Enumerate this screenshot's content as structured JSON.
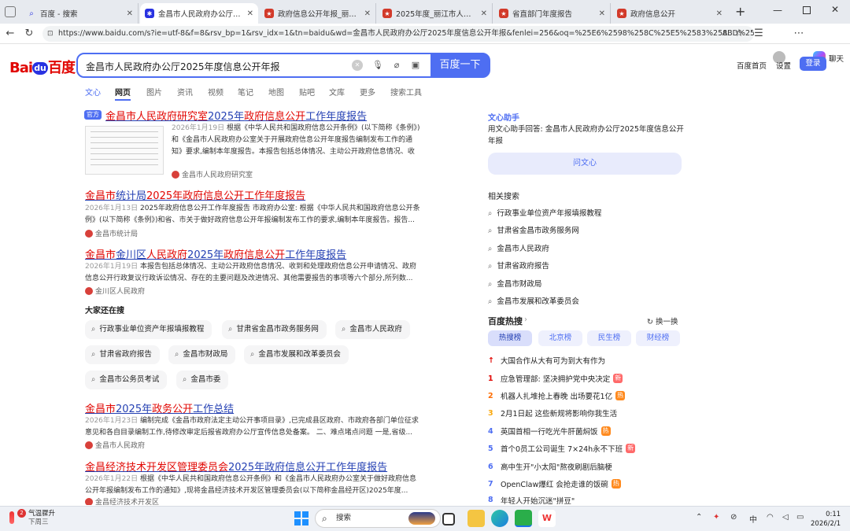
{
  "tabs": [
    {
      "title": "百度 - 搜索",
      "icon": "search-icon",
      "active": false
    },
    {
      "title": "金昌市人民政府办公厅2025年",
      "icon": "baidu-icon",
      "active": true
    },
    {
      "title": "政府信息公开年报_丽江市人民",
      "icon": "gov-emblem-icon",
      "active": false
    },
    {
      "title": "2025年度_丽江市人民政府",
      "icon": "gov-emblem-icon",
      "active": false
    },
    {
      "title": "省直部门年度报告",
      "icon": "gov-emblem-icon",
      "active": false
    },
    {
      "title": "政府信息公开",
      "icon": "gov-emblem-icon",
      "active": false
    }
  ],
  "browser": {
    "url": "https://www.baidu.com/s?ie=utf-8&f=8&rsv_bp=1&rsv_idx=1&tn=baidu&wd=金昌市人民政府办公厅2025年度信息公开年报&fenlei=256&oq=%25E6%2598%258C%25E5%2583%258BD%25...",
    "chat_label": "聊天"
  },
  "baidu": {
    "logo_left": "Bai",
    "logo_paw": "du",
    "logo_right": "百度",
    "query": "金昌市人民政府办公厅2025年度信息公开年报",
    "search_button": "百度一下",
    "top_links": [
      "百度首页",
      "设置"
    ],
    "login": "登录"
  },
  "result_tabs": [
    "文心",
    "网页",
    "图片",
    "资讯",
    "视频",
    "笔记",
    "地图",
    "贴吧",
    "文库",
    "更多",
    "搜索工具"
  ],
  "results": [
    {
      "badge": "官方",
      "title_parts": [
        [
          "金昌市人民政府研究室",
          1
        ],
        [
          "2025年",
          0
        ],
        [
          "政府信息公开",
          1
        ],
        [
          "工作年度报告",
          0
        ]
      ],
      "date": "2026年1月19日",
      "desc": "根据《中华人民共和国政府信息公开条例》(以下简称《条例》)和《金昌市人民政府办公室关于开展政府信息公开年度报告编制发布工作的通知》要求,编制本年度报告。本报告包括总体情况、主动公开政府信息情况、收到...",
      "source": "金昌市人民政府研究室"
    },
    {
      "title_parts": [
        [
          "金昌市",
          1
        ],
        [
          "统计局",
          0
        ],
        [
          "2025年政府信息公开工作年度报告",
          1
        ]
      ],
      "date": "2026年1月13日",
      "desc": "2025年政府信息公开工作年度报告 市政府办公室: 根据《中华人民共和国政府信息公开条例》(以下简称《条例》)和省、市关于做好政府信息公开年报编制发布工作的要求,编制本年度报告。报告...",
      "source": "金昌市统计局"
    },
    {
      "title_parts": [
        [
          "金昌市",
          1
        ],
        [
          "金川区",
          0
        ],
        [
          "人民政府",
          1
        ],
        [
          "2025年",
          0
        ],
        [
          "政府信息公开",
          1
        ],
        [
          "工作年度报告",
          0
        ]
      ],
      "date": "2026年1月19日",
      "desc": "本报告包括总体情况、主动公开政府信息情况、收到和处理政府信息公开申请情况、政府信息公开行政复议行政诉讼情况、存在的主要问题及改进情况、其他需要报告的事项等六个部分,所列数...",
      "source": "金川区人民政府"
    },
    {
      "title_parts": [
        [
          "金昌市",
          1
        ],
        [
          "2025年",
          0
        ],
        [
          "政务公开",
          1
        ],
        [
          "工作总结",
          0
        ]
      ],
      "date": "2026年1月23日",
      "desc": "编制完成《金昌市政府法定主动公开事项目录》,已完成县区政府、市政府各部门单位征求意见和各自目录编制工作,待修改审定后报省政府办公厅宣传信息处备案。 二、难点堵点问题 一是,省级...",
      "source": "金昌市人民政府"
    },
    {
      "title_parts": [
        [
          "金昌经济技术开发区管理委员会",
          1
        ],
        [
          "2025年政府信息公开工作年度报告",
          0
        ]
      ],
      "date": "2026年1月22日",
      "desc": "根据《中华人民共和国政府信息公开条例》和《金昌市人民政府办公室关于做好政府信息公开年报编制发布工作的通知》,现将金昌经济技术开发区管理委员会(以下简称金昌经开区)2025年度...",
      "source": "金昌经济技术开发区"
    }
  ],
  "also_searched": {
    "heading": "大家还在搜",
    "items": [
      "行政事业单位资产年报填报教程",
      "甘肃省金昌市政务服务网",
      "金昌市人民政府",
      "甘肃省政府报告",
      "金昌市财政局",
      "金昌市发展和改革委员会",
      "金昌市公务员考试",
      "金昌市委"
    ]
  },
  "wenxin": {
    "heading": "文心助手",
    "text": "用文心助手回答: 金昌市人民政府办公厅2025年度信息公开年报",
    "button": "问文心"
  },
  "related": {
    "heading": "相关搜索",
    "items": [
      "行政事业单位资产年报填报教程",
      "甘肃省金昌市政务服务网",
      "金昌市人民政府",
      "甘肃省政府报告",
      "金昌市财政局",
      "金昌市发展和改革委员会"
    ]
  },
  "hot": {
    "heading": "百度热搜",
    "refresh": "换一换",
    "tabs": [
      "热搜榜",
      "北京榜",
      "民生榜",
      "财经榜"
    ],
    "items": [
      {
        "rank": "↑",
        "text": "大国合作从大有可为到大有作为",
        "badge": ""
      },
      {
        "rank": "1",
        "text": "应急管理部: 坚决拥护党中央决定",
        "badge": "新"
      },
      {
        "rank": "2",
        "text": "机器人扎堆抢上春晚 出场要花1亿",
        "badge": "热"
      },
      {
        "rank": "3",
        "text": "2月1日起 这些新规将影响你我生活",
        "badge": ""
      },
      {
        "rank": "4",
        "text": "英国首相一行吃光牛肝菌焖饭",
        "badge": "热"
      },
      {
        "rank": "5",
        "text": "首个0员工公司诞生 7×24h永不下班",
        "badge": "新"
      },
      {
        "rank": "6",
        "text": "高中生开\"小太阳\"熬夜刷剧后脑梗",
        "badge": ""
      },
      {
        "rank": "7",
        "text": "OpenClaw爆红 会抢走谁的饭碗",
        "badge": "热"
      },
      {
        "rank": "8",
        "text": "年轻人开始沉迷\"拼豆\"",
        "badge": ""
      }
    ]
  },
  "taskbar": {
    "weather_badge": "2",
    "weather_line1": "气温骤升",
    "weather_line2": "下周三",
    "search_label": "搜索",
    "time": "0:11",
    "date": "2026/2/1",
    "ime": "中"
  },
  "colors": {
    "accent": "#4e6ef2",
    "result_link": "#2440b3",
    "highlight": "#e10602"
  }
}
